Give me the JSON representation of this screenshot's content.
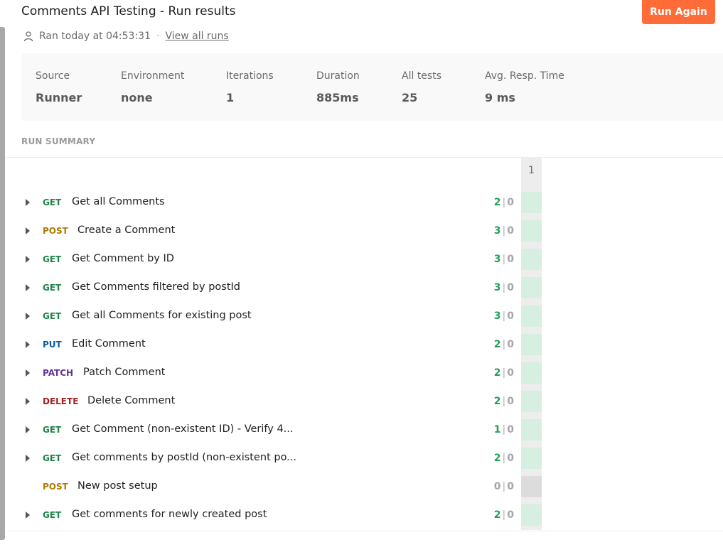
{
  "header": {
    "title": "Comments API Testing - Run results",
    "run_again_label": "Run Again",
    "ran_text": "Ran today at 04:53:31",
    "separator": "·",
    "view_all_runs": "View all runs"
  },
  "stats": {
    "source": {
      "label": "Source",
      "value": "Runner"
    },
    "environment": {
      "label": "Environment",
      "value": "none"
    },
    "iterations": {
      "label": "Iterations",
      "value": "1"
    },
    "duration": {
      "label": "Duration",
      "value": "885ms"
    },
    "all_tests": {
      "label": "All tests",
      "value": "25"
    },
    "avg_resp_time": {
      "label": "Avg. Resp. Time",
      "value": "9 ms"
    }
  },
  "summary": {
    "heading": "RUN SUMMARY",
    "iteration_header": "1",
    "count_separator": "|",
    "rows": [
      {
        "method": "GET",
        "name": "Get all Comments",
        "passed": "2",
        "failed": "0",
        "expandable": true
      },
      {
        "method": "POST",
        "name": "Create a Comment",
        "passed": "3",
        "failed": "0",
        "expandable": true
      },
      {
        "method": "GET",
        "name": "Get Comment by ID",
        "passed": "3",
        "failed": "0",
        "expandable": true
      },
      {
        "method": "GET",
        "name": "Get Comments filtered by postId",
        "passed": "3",
        "failed": "0",
        "expandable": true
      },
      {
        "method": "GET",
        "name": "Get all Comments for existing post",
        "passed": "3",
        "failed": "0",
        "expandable": true
      },
      {
        "method": "PUT",
        "name": "Edit Comment",
        "passed": "2",
        "failed": "0",
        "expandable": true
      },
      {
        "method": "PATCH",
        "name": "Patch Comment",
        "passed": "2",
        "failed": "0",
        "expandable": true
      },
      {
        "method": "DELETE",
        "name": "Delete Comment",
        "passed": "2",
        "failed": "0",
        "expandable": true
      },
      {
        "method": "GET",
        "name": "Get Comment (non-existent ID) - Verify 4...",
        "passed": "1",
        "failed": "0",
        "expandable": true
      },
      {
        "method": "GET",
        "name": "Get comments by postId (non-existent po...",
        "passed": "2",
        "failed": "0",
        "expandable": true
      },
      {
        "method": "POST",
        "name": "New post setup",
        "passed": "0",
        "failed": "0",
        "expandable": false
      },
      {
        "method": "GET",
        "name": "Get comments for newly created post",
        "passed": "2",
        "failed": "0",
        "expandable": true
      }
    ]
  },
  "colors": {
    "accent": "#ff6c37",
    "GET": "#1e8449",
    "POST": "#ad7a03",
    "PUT": "#0a5aa8",
    "PATCH": "#623497",
    "DELETE": "#a81d1d",
    "cell_pass": "#d7efe0",
    "cell_none": "#dcdcdc"
  }
}
